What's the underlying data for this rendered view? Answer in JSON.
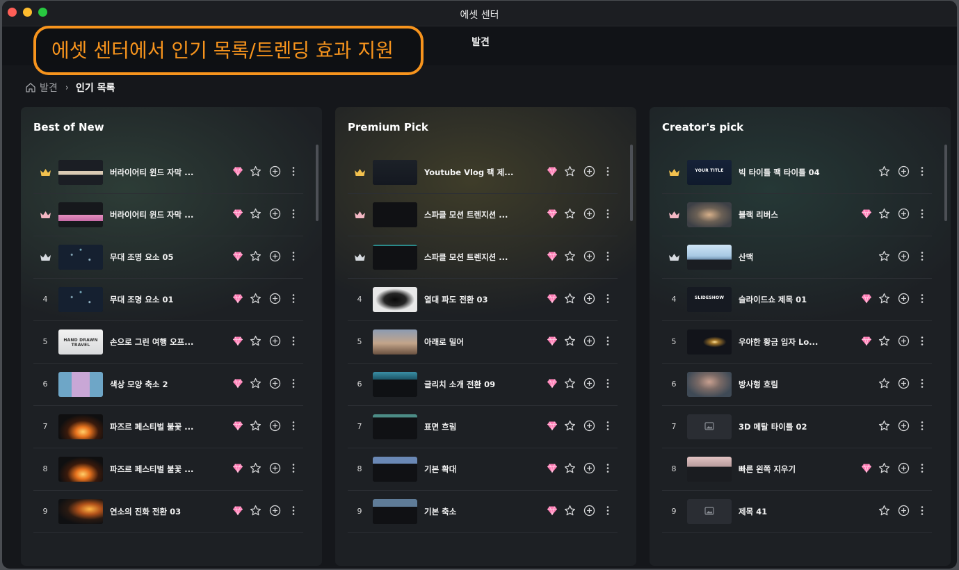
{
  "window": {
    "title": "에셋 센터"
  },
  "topbar": {
    "tab": "발견"
  },
  "annotation": {
    "text": "에셋 센터에서 인기 목록/트렌딩 효과 지원"
  },
  "breadcrumb": {
    "home": "발견",
    "separator": "›",
    "current": "인기 목록"
  },
  "colors": {
    "accent": "#f7941d",
    "gem": "#ff7eb6",
    "crown_gold": "#f2c14e",
    "crown_pink": "#f4b8c4",
    "crown_silver": "#d7dbe0"
  },
  "panels": [
    {
      "title": "Best of New",
      "items": [
        {
          "rank": "",
          "crown": "gold",
          "name": "버라이어티 윈드 자막 ...",
          "premium": true,
          "thumb": "banner"
        },
        {
          "rank": "",
          "crown": "pink",
          "name": "버라이어티 윈드 자막 ...",
          "premium": true,
          "thumb": "pink-text"
        },
        {
          "rank": "",
          "crown": "silver",
          "name": "무대 조명 요소 05",
          "premium": true,
          "thumb": "dark-sparks"
        },
        {
          "rank": "4",
          "crown": "",
          "name": "무대 조명 요소 01",
          "premium": true,
          "thumb": "dark-sparks"
        },
        {
          "rank": "5",
          "crown": "",
          "name": "손으로 그린 여행 오프...",
          "premium": true,
          "thumb": "hand-drawn",
          "thumb_text": "HAND DRAWN TRAVEL"
        },
        {
          "rank": "6",
          "crown": "",
          "name": "색상 모양 축소 2",
          "premium": true,
          "thumb": "shapes"
        },
        {
          "rank": "7",
          "crown": "",
          "name": "파즈르 페스티벌 불꽃 ...",
          "premium": true,
          "thumb": "fire"
        },
        {
          "rank": "8",
          "crown": "",
          "name": "파즈르 페스티벌 불꽃 ...",
          "premium": true,
          "thumb": "fire"
        },
        {
          "rank": "9",
          "crown": "",
          "name": "연소의 진화 전환 03",
          "premium": true,
          "thumb": "burn"
        }
      ]
    },
    {
      "title": "Premium Pick",
      "items": [
        {
          "rank": "",
          "crown": "gold",
          "name": "Youtube Vlog 팩 제...",
          "premium": true,
          "thumb": "vlog"
        },
        {
          "rank": "",
          "crown": "pink",
          "name": "스파클 모션 트렌지션 ...",
          "premium": true,
          "thumb": "black"
        },
        {
          "rank": "",
          "crown": "silver",
          "name": "스파클 모션 트렌지션 ...",
          "premium": true,
          "thumb": "black-teal"
        },
        {
          "rank": "4",
          "crown": "",
          "name": "열대 파도 전환 03",
          "premium": true,
          "thumb": "ink"
        },
        {
          "rank": "5",
          "crown": "",
          "name": "아래로 밀어",
          "premium": true,
          "thumb": "desert"
        },
        {
          "rank": "6",
          "crown": "",
          "name": "글리치 소개 전환 09",
          "premium": true,
          "thumb": "glitch"
        },
        {
          "rank": "7",
          "crown": "",
          "name": "표면 흐림",
          "premium": true,
          "thumb": "teal-strip"
        },
        {
          "rank": "8",
          "crown": "",
          "name": "기본 확대",
          "premium": true,
          "thumb": "blue-strip"
        },
        {
          "rank": "9",
          "crown": "",
          "name": "기본 축소",
          "premium": true,
          "thumb": "city-strip"
        }
      ]
    },
    {
      "title": "Creator's pick",
      "items": [
        {
          "rank": "",
          "crown": "gold",
          "name": "빅 타이틀 팩 타이틀 04",
          "premium": false,
          "thumb": "your-title",
          "thumb_text": "YOUR TITLE"
        },
        {
          "rank": "",
          "crown": "pink",
          "name": "블랙 리버스",
          "premium": true,
          "thumb": "bird"
        },
        {
          "rank": "",
          "crown": "silver",
          "name": "산맥",
          "premium": false,
          "thumb": "sky"
        },
        {
          "rank": "4",
          "crown": "",
          "name": "슬라이드쇼 제목 01",
          "premium": true,
          "thumb": "slideshow",
          "thumb_text": "SLIDESHOW"
        },
        {
          "rank": "5",
          "crown": "",
          "name": "우아한 황금 입자 Lo...",
          "premium": true,
          "thumb": "gold-particle"
        },
        {
          "rank": "6",
          "crown": "",
          "name": "방사형 흐림",
          "premium": false,
          "thumb": "portrait"
        },
        {
          "rank": "7",
          "crown": "",
          "name": "3D 메탈 타이틀 02",
          "premium": false,
          "thumb": "placeholder"
        },
        {
          "rank": "8",
          "crown": "",
          "name": "빠른 왼쪽 지우기",
          "premium": true,
          "thumb": "pink-sky"
        },
        {
          "rank": "9",
          "crown": "",
          "name": "제목 41",
          "premium": false,
          "thumb": "placeholder"
        }
      ]
    }
  ]
}
